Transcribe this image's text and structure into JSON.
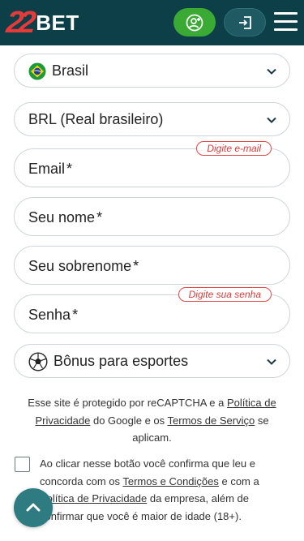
{
  "header": {
    "logo_number": "22",
    "logo_text": "BET",
    "register_icon": "user-plus-icon",
    "login_icon": "login-icon",
    "menu_icon": "hamburger-icon",
    "colors": {
      "background": "#0c3f47",
      "register": "#3aaa35",
      "brand_red": "#e63a3a"
    }
  },
  "form": {
    "country": {
      "value": "Brasil",
      "flag": "brazil-flag-icon"
    },
    "currency": {
      "value": "BRL (Real brasileiro)"
    },
    "email": {
      "placeholder": "Email",
      "required_mark": "*",
      "hint": "Digite e-mail"
    },
    "first_name": {
      "placeholder": "Seu nome",
      "required_mark": "*"
    },
    "last_name": {
      "placeholder": "Seu sobrenome",
      "required_mark": "*"
    },
    "password": {
      "placeholder": "Senha",
      "required_mark": "*",
      "hint": "Digite sua senha"
    },
    "bonus": {
      "value": "Bônus para esportes",
      "icon": "soccer-ball-icon"
    }
  },
  "recaptcha": {
    "text_1": "Esse site é protegido por reCAPTCHA e a ",
    "privacy_link": "Política de Privacidade",
    "text_2": " do Google e os ",
    "terms_link": "Termos de Serviço",
    "text_3": " se aplicam."
  },
  "consent": {
    "text_1": "Ao clicar nesse botão você confirma que leu e concorda com os ",
    "terms_link": "Termos e Condições",
    "text_2": " e com a ",
    "privacy_link": "Política de Privacidade",
    "text_3": " da empresa, além de confirmar que você é maior de idade (18+).",
    "checked": false
  },
  "scroll_top": {
    "icon": "chevron-up-icon"
  }
}
